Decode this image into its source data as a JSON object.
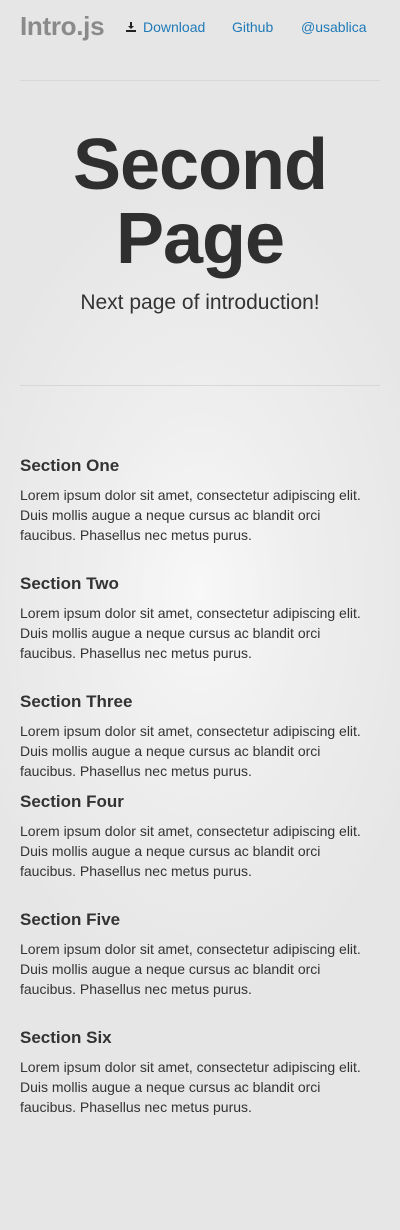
{
  "header": {
    "brand": "Intro.js",
    "nav": {
      "download": {
        "label": "Download",
        "icon": "download-icon"
      },
      "github": "Github",
      "twitter": "@usablica"
    }
  },
  "hero": {
    "title_line1": "Second",
    "title_line2": "Page",
    "subtitle": "Next page of introduction!"
  },
  "sections": [
    {
      "title": "Section One",
      "body": "Lorem ipsum dolor sit amet, consectetur adipiscing elit. Duis mollis augue a neque cursus ac blandit orci faucibus. Phasellus nec metus purus."
    },
    {
      "title": "Section Two",
      "body": "Lorem ipsum dolor sit amet, consectetur adipiscing elit. Duis mollis augue a neque cursus ac blandit orci faucibus. Phasellus nec metus purus."
    },
    {
      "title": "Section Three",
      "body": "Lorem ipsum dolor sit amet, consectetur adipiscing elit. Duis mollis augue a neque cursus ac blandit orci faucibus. Phasellus nec metus purus."
    },
    {
      "title": "Section Four",
      "body": "Lorem ipsum dolor sit amet, consectetur adipiscing elit. Duis mollis augue a neque cursus ac blandit orci faucibus. Phasellus nec metus purus."
    },
    {
      "title": "Section Five",
      "body": "Lorem ipsum dolor sit amet, consectetur adipiscing elit. Duis mollis augue a neque cursus ac blandit orci faucibus. Phasellus nec metus purus."
    },
    {
      "title": "Section Six",
      "body": "Lorem ipsum dolor sit amet, consectetur adipiscing elit. Duis mollis augue a neque cursus ac blandit orci faucibus. Phasellus nec metus purus."
    }
  ],
  "colors": {
    "link": "#1f7ab8",
    "brand": "#8a8a8a",
    "text": "#333333",
    "background": "#e6e6e6"
  }
}
